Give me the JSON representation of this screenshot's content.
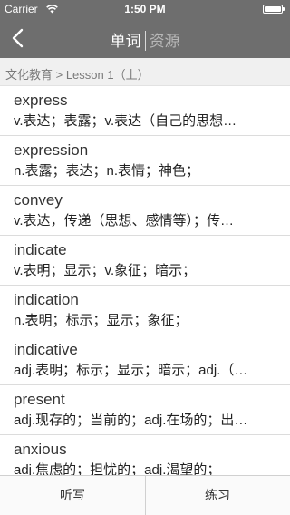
{
  "status": {
    "carrier": "Carrier",
    "time": "1:50 PM"
  },
  "nav": {
    "tab_active": "单词",
    "tab_inactive": "资源"
  },
  "breadcrumb": "文化教育 > Lesson 1（上）",
  "words": [
    {
      "word": "express",
      "def": "v.表达；表露；v.表达（自己的思想…"
    },
    {
      "word": "expression",
      "def": "n.表露；表达；n.表情；神色；"
    },
    {
      "word": "convey",
      "def": "v.表达，传递（思想、感情等）；传…"
    },
    {
      "word": "indicate",
      "def": "v.表明；显示；v.象征；暗示；"
    },
    {
      "word": "indication",
      "def": "n.表明；标示；显示；象征；"
    },
    {
      "word": "indicative",
      "def": "adj.表明；标示；显示；暗示；adj.（…"
    },
    {
      "word": "present",
      "def": "adj.现存的；当前的；adj.在场的；出…"
    },
    {
      "word": "anxious",
      "def": "adj.焦虑的；担忧的；adj.渴望的；"
    }
  ],
  "tabbar": {
    "dictation": "听写",
    "practice": "练习"
  }
}
